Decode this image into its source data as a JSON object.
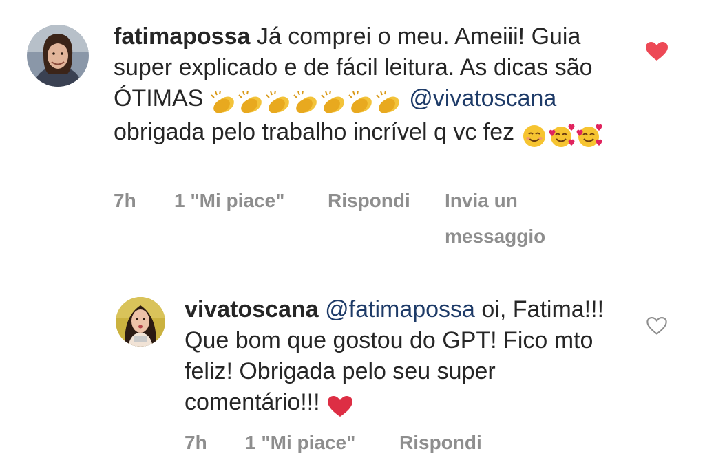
{
  "comments": [
    {
      "username": "fatimapossa",
      "text_part1": "Já comprei o meu. Ameiii! Guia super explicado e de fácil leitura. As dicas são ÓTIMAS",
      "mention": "@vivatoscana",
      "text_part2": "obrigada pelo trabalho incrível q vc fez",
      "time": "7h",
      "likes": "1 \"Mi piace\"",
      "reply": "Rispondi",
      "send_line1": "Invia un",
      "send_line2": "messaggio",
      "liked": true,
      "heart_color": "#ed4956"
    },
    {
      "username": "vivatoscana",
      "mention": "@fatimapossa",
      "text": "oi, Fatima!!! Que bom que gostou do GPT! Fico mto feliz! Obrigada pelo seu super comentário!!!",
      "time": "7h",
      "likes": "1 \"Mi piace\"",
      "reply": "Rispondi",
      "liked": false,
      "heart_color": "#8e8e8e"
    }
  ],
  "icons": {
    "clap": "clapping-hands-emoji",
    "smile": "smiling-face-emoji",
    "hearts_face": "smiling-face-with-hearts-emoji",
    "red_heart": "red-heart-emoji"
  },
  "colors": {
    "text": "#262626",
    "meta": "#8e8e8e",
    "mention": "#1e3b68",
    "like_red": "#ed4956"
  }
}
